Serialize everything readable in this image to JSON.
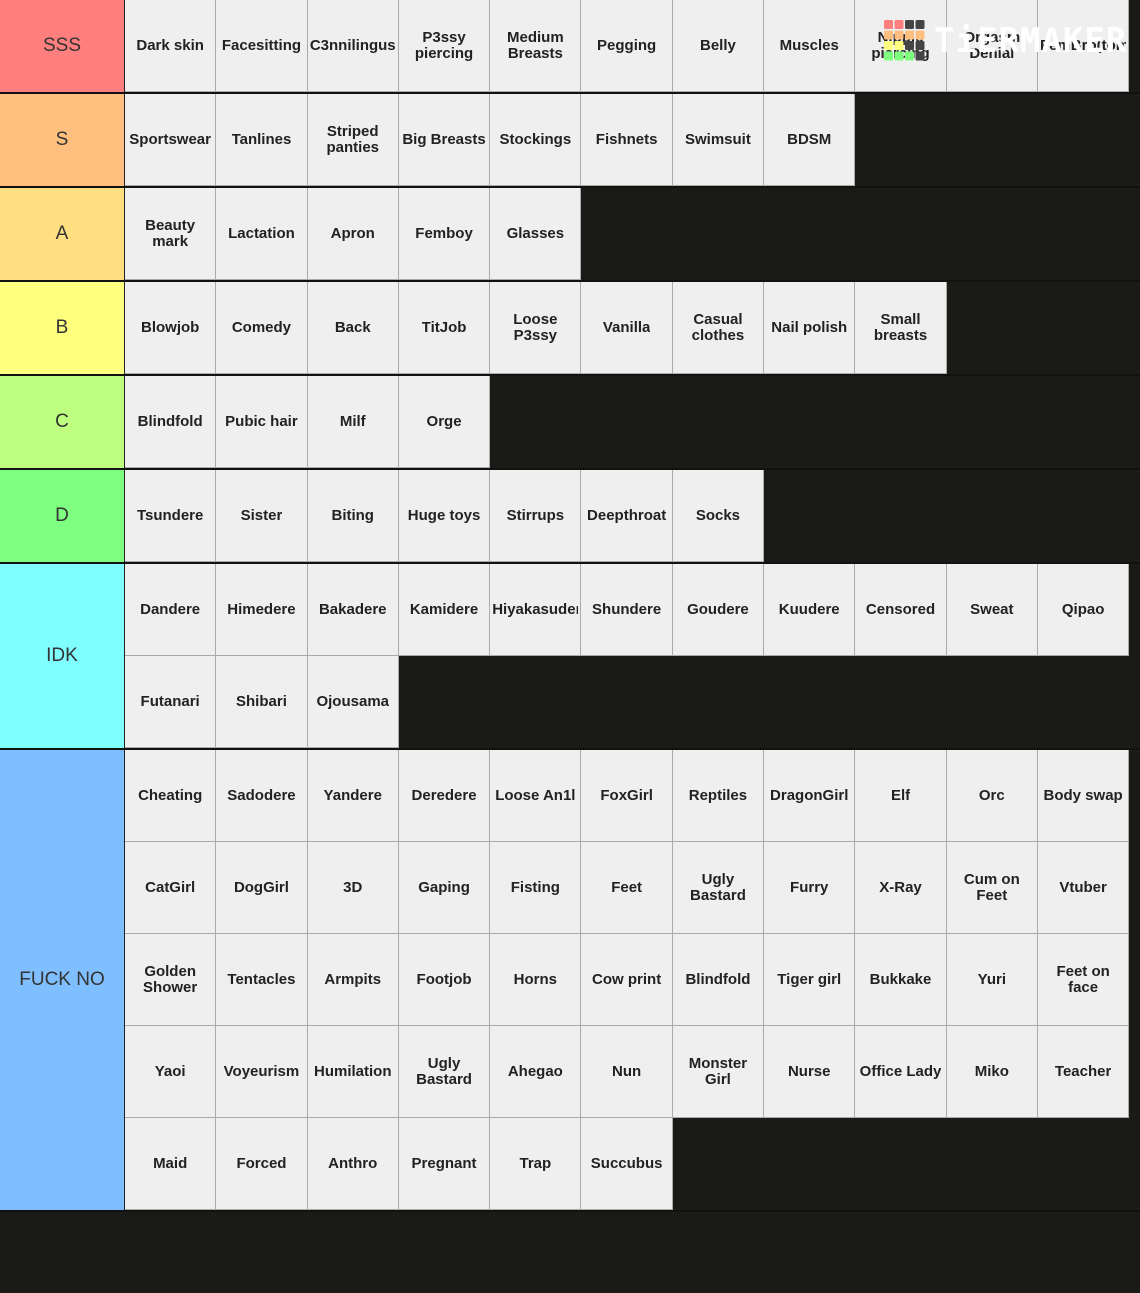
{
  "logo": {
    "text": "TiERMAKER",
    "grid_colors": [
      [
        "#ff7f7f",
        "#ff7f7f",
        "#444",
        "#444"
      ],
      [
        "#ffbf7f",
        "#ffbf7f",
        "#ffbf7f",
        "#ffbf7f"
      ],
      [
        "#ffff7f",
        "#ffff7f",
        "#444",
        "#444"
      ],
      [
        "#7fff7f",
        "#7fff7f",
        "#7fff7f",
        "#444"
      ]
    ]
  },
  "tiers": [
    {
      "label": "SSS",
      "color": "#ff7f7f",
      "items": [
        "Dark skin",
        "Facesitting",
        "C3nnilingus",
        "P3ssy piercing",
        "Medium Breasts",
        "Pegging",
        "Belly",
        "Muscles",
        "Nipple piercing",
        "Orgasm Denial",
        "FemBro(tom"
      ]
    },
    {
      "label": "S",
      "color": "#ffbf7f",
      "items": [
        "Sportswear",
        "Tanlines",
        "Striped panties",
        "Big Breasts",
        "Stockings",
        "Fishnets",
        "Swimsuit",
        "BDSM"
      ]
    },
    {
      "label": "A",
      "color": "#ffdf7f",
      "items": [
        "Beauty mark",
        "Lactation",
        "Apron",
        "Femboy",
        "Glasses"
      ]
    },
    {
      "label": "B",
      "color": "#ffff7f",
      "items": [
        "Blowjob",
        "Comedy",
        "Back",
        "TitJob",
        "Loose P3ssy",
        "Vanilla",
        "Casual clothes",
        "Nail polish",
        "Small breasts"
      ]
    },
    {
      "label": "C",
      "color": "#bfff7f",
      "items": [
        "Blindfold",
        "Pubic hair",
        "Milf",
        "Orge"
      ]
    },
    {
      "label": "D",
      "color": "#7fff7f",
      "items": [
        "Tsundere",
        "Sister",
        "Biting",
        "Huge toys",
        "Stirrups",
        "Deepthroat",
        "Socks"
      ]
    },
    {
      "label": "IDK",
      "color": "#7fffff",
      "items": [
        "Dandere",
        "Himedere",
        "Bakadere",
        "Kamidere",
        "Hiyakasuder",
        "Shundere",
        "Goudere",
        "Kuudere",
        "Censored",
        "Sweat",
        "Qipao",
        "Futanari",
        "Shibari",
        "Ojousama"
      ]
    },
    {
      "label": "FUCK NO",
      "color": "#7fbfff",
      "items": [
        "Cheating",
        "Sadodere",
        "Yandere",
        "Deredere",
        "Loose An1l",
        "FoxGirl",
        "Reptiles",
        "DragonGirl",
        "Elf",
        "Orc",
        "Body swap",
        "CatGirl",
        "DogGirl",
        "3D",
        "Gaping",
        "Fisting",
        "Feet",
        "Ugly Bastard",
        "Furry",
        "X-Ray",
        "Cum on Feet",
        "Vtuber",
        "Golden Shower",
        "Tentacles",
        "Armpits",
        "Footjob",
        "Horns",
        "Cow print",
        "Blindfold",
        "Tiger girl",
        "Bukkake",
        "Yuri",
        "Feet on face",
        "Yaoi",
        "Voyeurism",
        "Humilation",
        "Ugly Bastard",
        "Ahegao",
        "Nun",
        "Monster Girl",
        "Nurse",
        "Office Lady",
        "Miko",
        "Teacher",
        "Maid",
        "Forced",
        "Anthro",
        "Pregnant",
        "Trap",
        "Succubus"
      ]
    }
  ]
}
